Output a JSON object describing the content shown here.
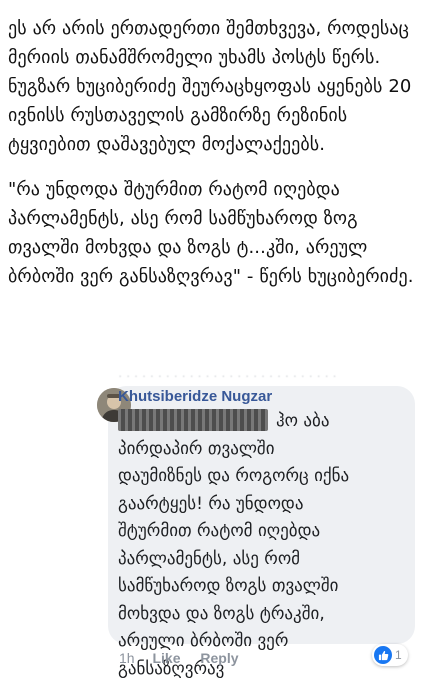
{
  "article": {
    "paragraph_1": "ეს არ არის ერთადერთი შემთხვევა, როდესაც მერიის თანამშრომელი უხამს პოსტს წერს. ნუგზარ ხუციბერიძე შეურაცხყოფას აყენებს 20 ივნისს რუსთაველის გამზირზე რეზინის ტყვიებით დაშავებულ მოქალაქეებს.",
    "paragraph_2": "\"რა უნდოდა შტურმით რატომ იღებდა პარლამენტს, ასე რომ სამწუხაროდ ზოგ თვალში მოხვდა და ზოგს ტ...კში, არეულ ბრბოში ვერ განსაზღვრავ\" - წერს ხუციბერიძე."
  },
  "comment": {
    "author": "Khutsiberidze Nugzar",
    "lines": [
      "ჰო აბა",
      "პირდაპირ თვალში",
      "დაუმიზნეს და როგორც იქნა",
      "გაარტყეს! რა უნდოდა",
      "შტურმით რატომ იღებდა",
      "პარლამენტს, ასე რომ",
      "სამწუხაროდ ზოგს თვალში",
      "მოხვდა და ზოგს ტრაკში,",
      "არეული ბრბოში ვერ",
      "განსაზღვრავ"
    ],
    "time": "1h",
    "like_label": "Like",
    "reply_label": "Reply",
    "reaction_count": "1",
    "reaction_icon": "thumbs-up-icon"
  },
  "colors": {
    "author_name": "#385898",
    "bubble_background": "#eef0f3",
    "action_text": "#8d949e",
    "like_badge": "#1877f2"
  }
}
